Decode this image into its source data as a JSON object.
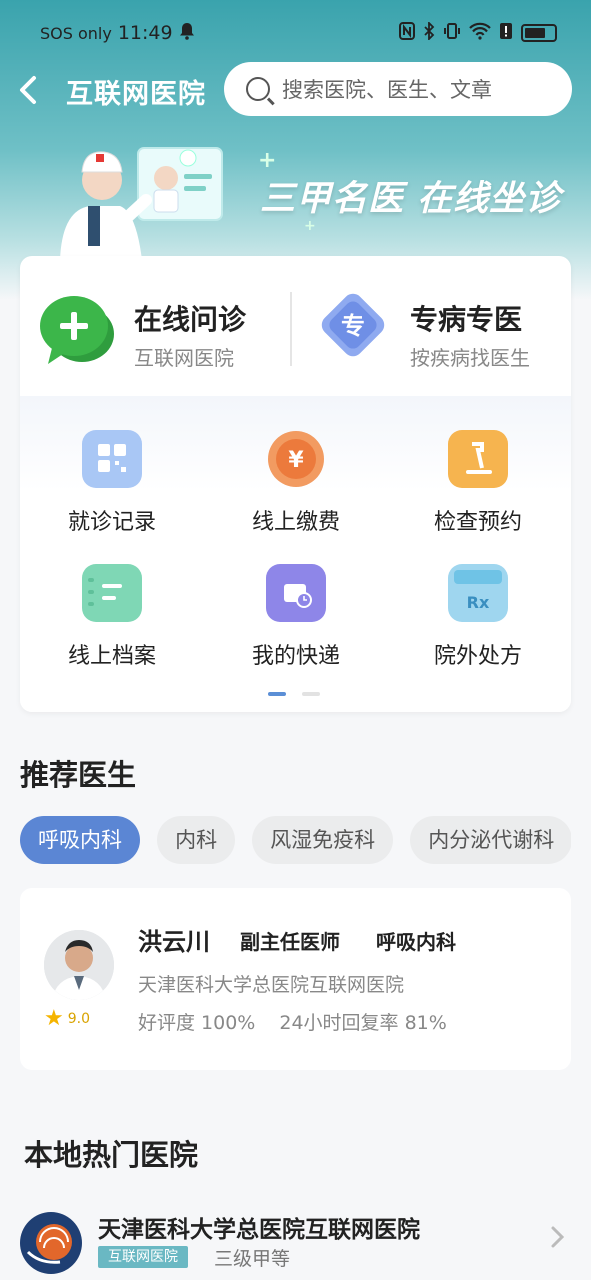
{
  "status_bar": {
    "carrier": "SOS only",
    "time": "11:49",
    "battery_icon": "battery-icon"
  },
  "nav": {
    "back_icon": "back-arrow-icon",
    "title": "互联网医院",
    "search_placeholder": "搜索医院、医生、文章"
  },
  "banner": {
    "slogan": "三甲名医 在线坐诊"
  },
  "features": [
    {
      "title": "在线问诊",
      "subtitle": "互联网医院",
      "icon": "chat-plus-icon"
    },
    {
      "title": "专病专医",
      "subtitle": "按疾病找医生",
      "icon": "specialty-badge-icon",
      "badge_text": "专"
    }
  ],
  "grid": [
    {
      "label": "就诊记录",
      "icon": "qr-record-icon"
    },
    {
      "label": "线上缴费",
      "icon": "yuan-coin-icon"
    },
    {
      "label": "检查预约",
      "icon": "microscope-icon"
    },
    {
      "label": "线上档案",
      "icon": "archive-icon"
    },
    {
      "label": "我的快递",
      "icon": "delivery-box-icon"
    },
    {
      "label": "院外处方",
      "icon": "prescription-shop-icon",
      "badge_text": "Rx"
    }
  ],
  "recommend": {
    "title": "推荐医生",
    "chips": [
      {
        "label": "呼吸内科",
        "active": true
      },
      {
        "label": "内科",
        "active": false
      },
      {
        "label": "风湿免疫科",
        "active": false
      },
      {
        "label": "内分泌代谢科",
        "active": false
      }
    ],
    "doctor": {
      "name": "洪云川",
      "title": "副主任医师",
      "department": "呼吸内科",
      "hospital": "天津医科大学总医院互联网医院",
      "rating": "9.0",
      "praise_rate": "好评度 100%",
      "reply_rate": "24小时回复率 81%"
    }
  },
  "hospitals": {
    "title": "本地热门医院",
    "items": [
      {
        "name": "天津医科大学总医院互联网医院",
        "tag": "互联网医院",
        "level": "三级甲等"
      }
    ]
  },
  "colors": {
    "accent": "#5b86d4",
    "teal": "#3aa3ad",
    "tag": "#6ab8c3"
  }
}
